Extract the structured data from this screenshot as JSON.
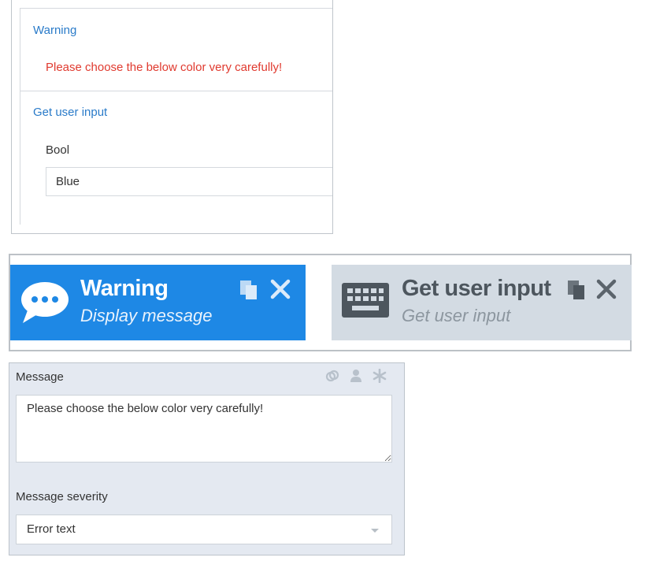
{
  "preview": {
    "warning_title": "Warning",
    "warning_message": "Please choose the below color very carefully!",
    "input_title": "Get user input",
    "bool_label": "Bool",
    "bool_value": "Blue"
  },
  "canvas": {
    "nodes": [
      {
        "title": "Warning",
        "subtitle": "Display message",
        "icon": "chat-bubble-icon",
        "color": "#1e88e5"
      },
      {
        "title": "Get user input",
        "subtitle": "Get user input",
        "icon": "keyboard-icon",
        "color": "#d3dbe3"
      }
    ]
  },
  "properties": {
    "message_label": "Message",
    "message_value": "Please choose the below color very carefully!",
    "severity_label": "Message severity",
    "severity_value": "Error text",
    "header_icons": [
      "link-icon",
      "user-icon",
      "asterisk-icon"
    ]
  },
  "colors": {
    "accent_blue": "#1e88e5",
    "link_blue": "#2a7bc9",
    "error_red": "#e03a2f",
    "panel_bg": "#e4e9f1"
  }
}
